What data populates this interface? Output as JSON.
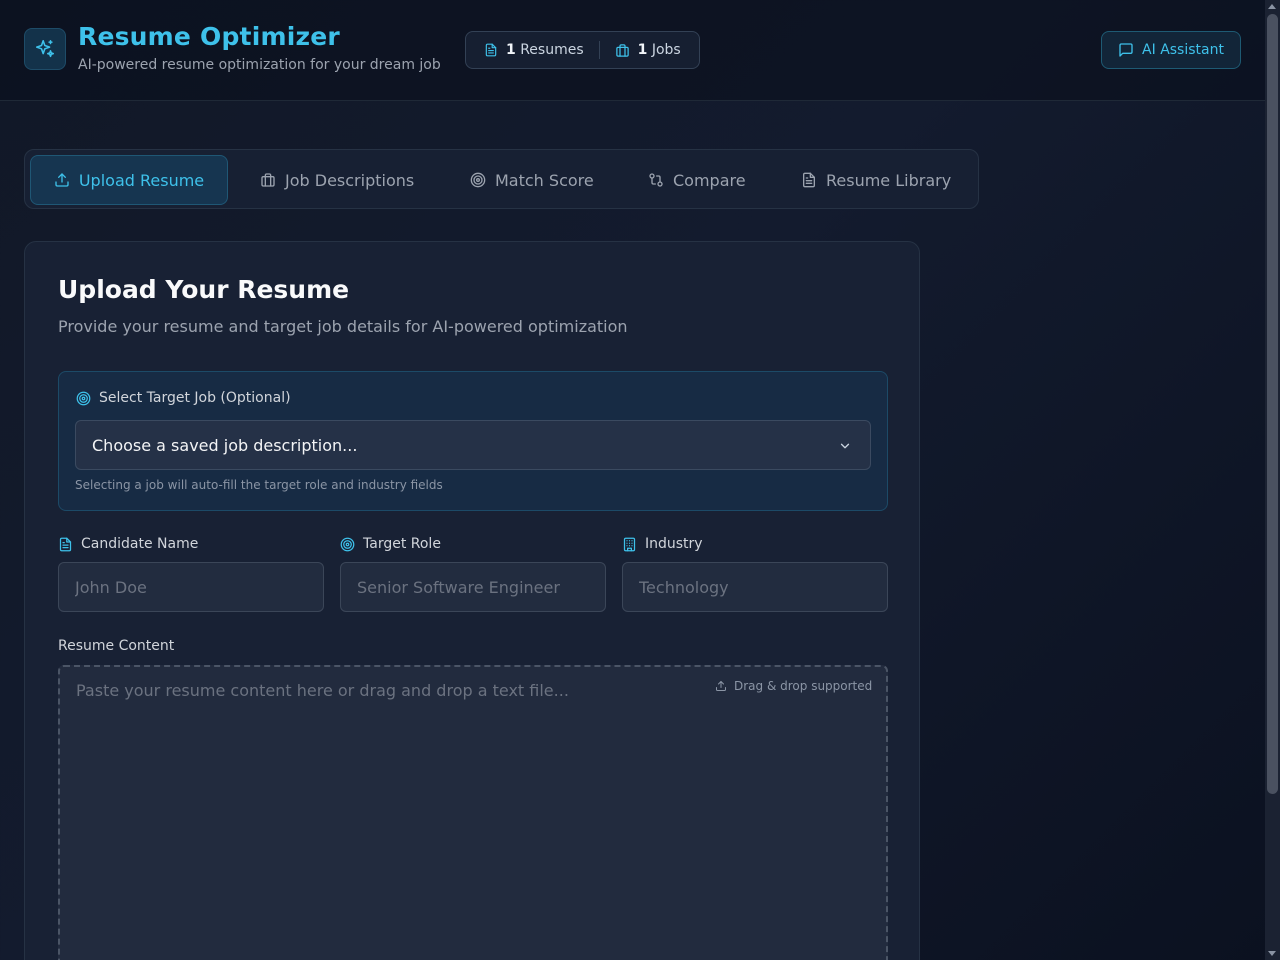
{
  "header": {
    "title": "Resume Optimizer",
    "subtitle": "AI-powered resume optimization for your dream job",
    "logo_icon": "sparkles-icon",
    "stats": {
      "resumes_count": "1",
      "resumes_label": "Resumes",
      "jobs_count": "1",
      "jobs_label": "Jobs"
    },
    "ai_assistant_label": "AI Assistant"
  },
  "tabs": [
    {
      "label": "Upload Resume",
      "icon": "upload-icon",
      "active": true
    },
    {
      "label": "Job Descriptions",
      "icon": "briefcase-icon",
      "active": false
    },
    {
      "label": "Match Score",
      "icon": "target-icon",
      "active": false
    },
    {
      "label": "Compare",
      "icon": "compare-icon",
      "active": false
    },
    {
      "label": "Resume Library",
      "icon": "file-icon",
      "active": false
    }
  ],
  "upload": {
    "title": "Upload Your Resume",
    "subtitle": "Provide your resume and target job details for AI-powered optimization",
    "target_job": {
      "label": "Select Target Job (Optional)",
      "selected": "Choose a saved job description...",
      "help": "Selecting a job will auto-fill the target role and industry fields"
    },
    "fields": {
      "candidate_name": {
        "label": "Candidate Name",
        "placeholder": "John Doe",
        "value": ""
      },
      "target_role": {
        "label": "Target Role",
        "placeholder": "Senior Software Engineer",
        "value": ""
      },
      "industry": {
        "label": "Industry",
        "placeholder": "Technology",
        "value": ""
      }
    },
    "resume_content": {
      "label": "Resume Content",
      "placeholder": "Paste your resume content here or drag and drop a text file...",
      "drag_hint": "Drag & drop supported"
    }
  },
  "colors": {
    "accent": "#3ec1ea",
    "background": "#111827",
    "card": "#182134"
  }
}
